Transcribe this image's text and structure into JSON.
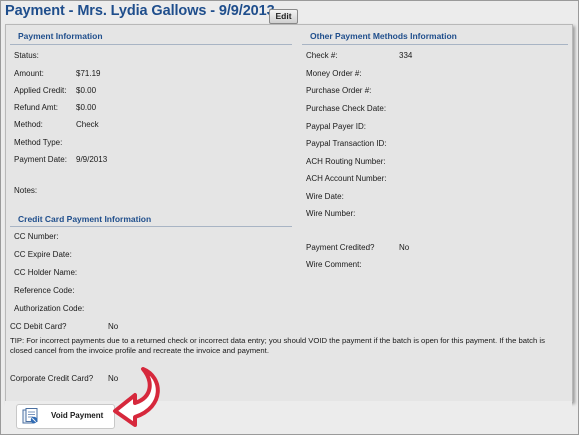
{
  "title": "Payment - Mrs. Lydia Gallows - 9/9/2013",
  "edit_label": "Edit",
  "payment_info": {
    "heading": "Payment Information",
    "fields": [
      {
        "label": "Status:",
        "value": ""
      },
      {
        "label": "Amount:",
        "value": "$71.19"
      },
      {
        "label": "Applied Credit:",
        "value": "$0.00"
      },
      {
        "label": "Refund Amt:",
        "value": "$0.00"
      },
      {
        "label": "Method:",
        "value": "Check"
      },
      {
        "label": "Method Type:",
        "value": ""
      },
      {
        "label": "Payment Date:",
        "value": "9/9/2013"
      },
      {
        "label": "Notes:",
        "value": ""
      }
    ]
  },
  "other_methods": {
    "heading": "Other Payment Methods Information",
    "fields": [
      {
        "label": "Check #:",
        "value": "334"
      },
      {
        "label": "Money Order #:",
        "value": ""
      },
      {
        "label": "Purchase Order #:",
        "value": ""
      },
      {
        "label": "Purchase Check Date:",
        "value": ""
      },
      {
        "label": "Paypal Payer ID:",
        "value": ""
      },
      {
        "label": "Paypal Transaction ID:",
        "value": ""
      },
      {
        "label": "ACH Routing Number:",
        "value": ""
      },
      {
        "label": "ACH Account Number:",
        "value": ""
      },
      {
        "label": "Wire Date:",
        "value": ""
      },
      {
        "label": "Wire Number:",
        "value": ""
      },
      {
        "label": "Payment Credited?",
        "value": "No"
      },
      {
        "label": "Wire Comment:",
        "value": ""
      }
    ]
  },
  "credit_card": {
    "heading": "Credit Card Payment Information",
    "fields": [
      {
        "label": "CC Number:",
        "value": ""
      },
      {
        "label": "CC Expire Date:",
        "value": ""
      },
      {
        "label": "CC Holder Name:",
        "value": ""
      },
      {
        "label": "Reference Code:",
        "value": ""
      },
      {
        "label": "Authorization Code:",
        "value": ""
      },
      {
        "label": "CC Debit Card?",
        "value": "No"
      }
    ]
  },
  "tip": "TIP: For incorrect payments due to a returned check or incorrect data entry; you should VOID the payment if the batch is open for this payment. If the batch is closed cancel from the invoice profile and recreate the invoice and payment.",
  "corporate_card": {
    "label": "Corporate Credit Card?",
    "value": "No"
  },
  "void_label": "Void Payment",
  "colors": {
    "title": "#1f4e8c",
    "panel": "#e5e5e5",
    "arrow": "#d6283c"
  },
  "icons": {
    "void": "document-void-icon",
    "pointer": "curved-arrow-icon"
  }
}
